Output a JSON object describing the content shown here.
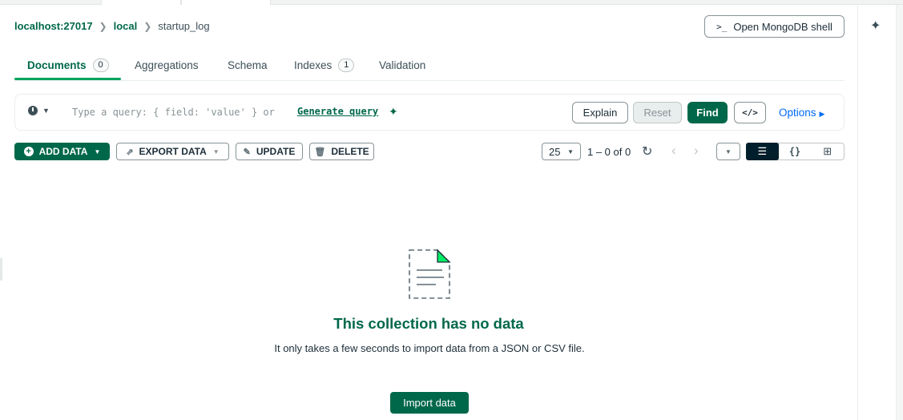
{
  "breadcrumb": {
    "host": "localhost:27017",
    "database": "local",
    "collection": "startup_log"
  },
  "header": {
    "shell_button_label": "Open MongoDB shell",
    "shell_icon": ">_"
  },
  "tabs": [
    {
      "label": "Documents",
      "count": "0",
      "active": true
    },
    {
      "label": "Aggregations"
    },
    {
      "label": "Schema"
    },
    {
      "label": "Indexes",
      "count": "1"
    },
    {
      "label": "Validation"
    }
  ],
  "query_bar": {
    "placeholder": "Type a query: { field: 'value' } or",
    "generate_label": "Generate query",
    "explain_label": "Explain",
    "reset_label": "Reset",
    "find_label": "Find",
    "code_label": "</>",
    "options_label": "Options"
  },
  "toolbar": {
    "add_data_label": "ADD DATA",
    "export_data_label": "EXPORT DATA",
    "update_label": "UPDATE",
    "delete_label": "DELETE"
  },
  "pagination": {
    "page_size": "25",
    "range": "1 – 0 of 0"
  },
  "view_modes": [
    "list",
    "json",
    "table"
  ],
  "empty_state": {
    "title": "This collection has no data",
    "description": "It only takes a few seconds to import data from a JSON or CSV file.",
    "import_label": "Import data"
  },
  "colors": {
    "brand_green": "#00684a",
    "accent_green": "#00a35c",
    "link_blue": "#016bf8",
    "dark": "#001e2b"
  }
}
